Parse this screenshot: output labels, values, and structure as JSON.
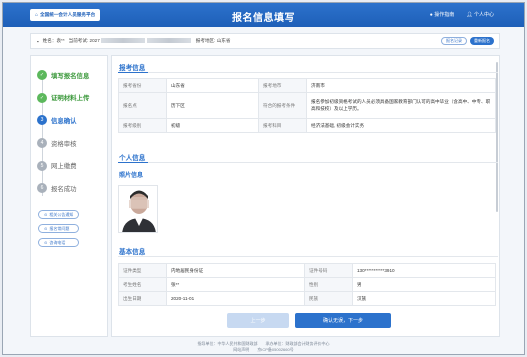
{
  "header": {
    "home_label": "全国统一会计人员服务平台",
    "title": "报名信息填写",
    "guide_label": "操作指南",
    "user_center_label": "个人中心"
  },
  "infobar": {
    "name_label": "姓名：",
    "name_value": "袁**",
    "exam_label": "当前考试: 2027",
    "region_label": "报考地区: 山东省",
    "btn_history": "报名记录",
    "btn_reselect": "重新报名"
  },
  "steps": [
    {
      "num": "✓",
      "label": "填写报名信息",
      "state": "done"
    },
    {
      "num": "✓",
      "label": "证明材料上传",
      "state": "done"
    },
    {
      "num": "3",
      "label": "信息确认",
      "state": "cur"
    },
    {
      "num": "4",
      "label": "资格审核",
      "state": "todo"
    },
    {
      "num": "5",
      "label": "网上缴费",
      "state": "todo"
    },
    {
      "num": "6",
      "label": "报名成功",
      "state": "todo"
    }
  ],
  "side_links": [
    "相关公告通知",
    "报名常问题",
    "咨询电话"
  ],
  "exam_info": {
    "title": "报考信息",
    "rows": [
      {
        "k1": "报考省份",
        "v1": "山东省",
        "k2": "报考地市",
        "v2": "济南市"
      },
      {
        "k1": "报名点",
        "v1": "历下区",
        "k2": "符合的报考条件",
        "v2": "报名参加初级资格考试的人员必须具备国家教育部门认可的高中毕业（含高中、中专、职高和技校）及以上学历。"
      },
      {
        "k1": "报考级别",
        "v1": "初级",
        "k2": "报考科目",
        "v2": "经济法基础, 初级会计实务"
      }
    ]
  },
  "personal": {
    "title": "个人信息",
    "photo_title": "照片信息",
    "basic_title": "基本信息",
    "rows": [
      {
        "k1": "证件类型",
        "v1": "内地居民身份证",
        "k2": "证件号码",
        "v2": "130***********3910"
      },
      {
        "k1": "考生姓名",
        "v1": "张**",
        "k2": "性别",
        "v2": "男"
      },
      {
        "k1": "出生日期",
        "v1": "2020-11-01",
        "k2": "民族",
        "v2": "汉族"
      }
    ]
  },
  "buttons": {
    "prev": "上一步",
    "next": "确认无误，下一步"
  },
  "footer": {
    "line1": "指导单位：中华人民共和国财政部　　承办单位：财政部会计财务评价中心",
    "line2": "网站声明　　京ICP备05002660号"
  },
  "colors": {
    "primary": "#2c72cc",
    "done": "#5cb85c",
    "pending": "#a9b1bb"
  }
}
